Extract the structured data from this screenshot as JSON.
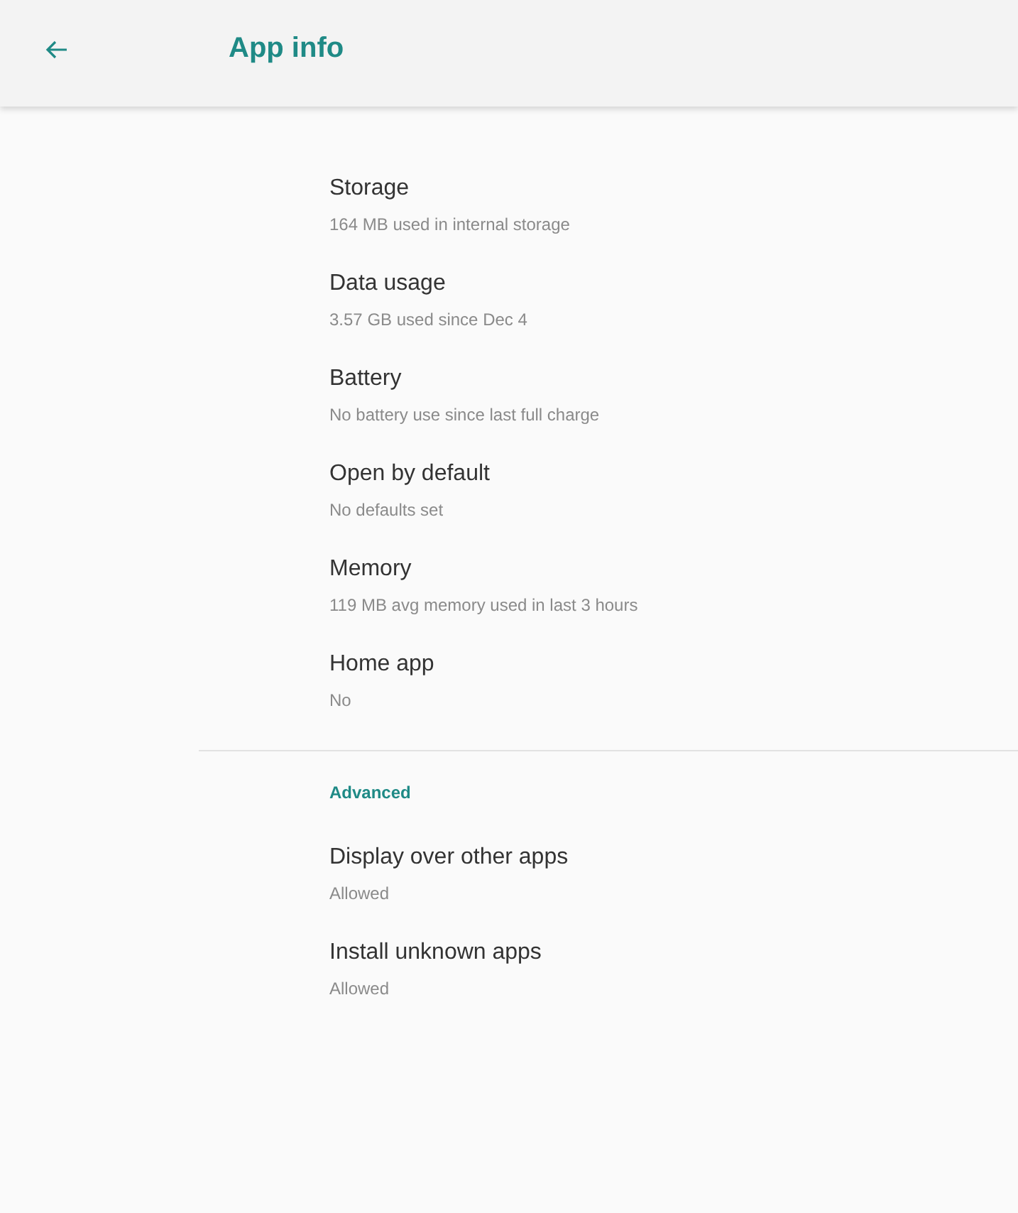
{
  "app_bar": {
    "title": "App info"
  },
  "items": [
    {
      "title": "Storage",
      "summary": "164 MB used in internal storage"
    },
    {
      "title": "Data usage",
      "summary": "3.57 GB used since Dec 4"
    },
    {
      "title": "Battery",
      "summary": "No battery use since last full charge"
    },
    {
      "title": "Open by default",
      "summary": "No defaults set"
    },
    {
      "title": "Memory",
      "summary": "119 MB avg memory used in last 3 hours"
    },
    {
      "title": "Home app",
      "summary": "No"
    }
  ],
  "advanced": {
    "header": "Advanced",
    "items": [
      {
        "title": "Display over other apps",
        "summary": "Allowed"
      },
      {
        "title": "Install unknown apps",
        "summary": "Allowed"
      }
    ]
  }
}
